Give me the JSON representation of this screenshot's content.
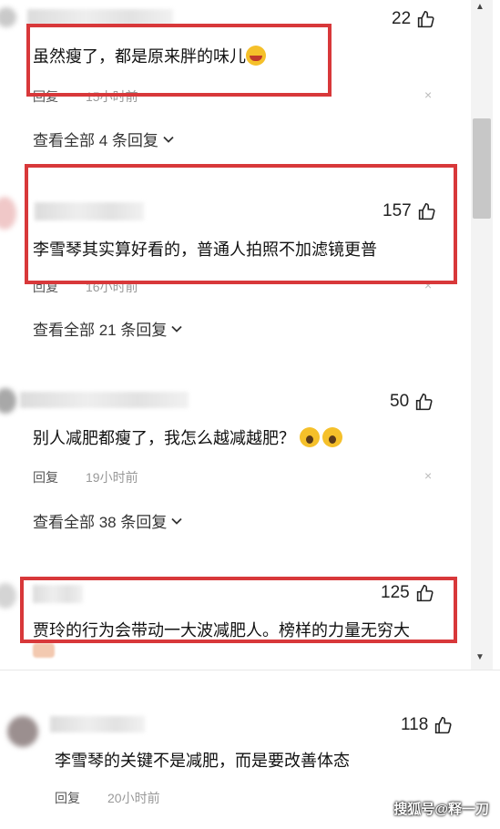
{
  "scroll_area": {
    "up_arrow": "▲",
    "down_arrow": "▼"
  },
  "comments": [
    {
      "text": "虽然瘦了，都是原来胖的味儿",
      "likes": "22",
      "reply_label": "回复",
      "time": "15小时前",
      "view_all": "查看全部 4 条回复",
      "close": "×"
    },
    {
      "text": "李雪琴其实算好看的，普通人拍照不加滤镜更普",
      "likes": "157",
      "reply_label": "回复",
      "time": "16小时前",
      "view_all": "查看全部 21 条回复",
      "close": "×"
    },
    {
      "text": "别人减肥都瘦了，我怎么越减越肥？",
      "likes": "50",
      "reply_label": "回复",
      "time": "19小时前",
      "view_all": "查看全部 38 条回复",
      "close": "×"
    },
    {
      "text": "贾玲的行为会带动一大波减肥人。榜样的力量无穷大",
      "likes": "125"
    },
    {
      "text": "李雪琴的关键不是减肥，而是要改善体态",
      "likes": "118",
      "reply_label": "回复",
      "time": "20小时前"
    }
  ],
  "watermark": "搜狐号@释一刀",
  "colors": {
    "highlight_box": "#d8383a"
  },
  "icons": {
    "like": "thumbs-up-icon",
    "expand": "chevron-down-icon",
    "close": "close-icon"
  }
}
